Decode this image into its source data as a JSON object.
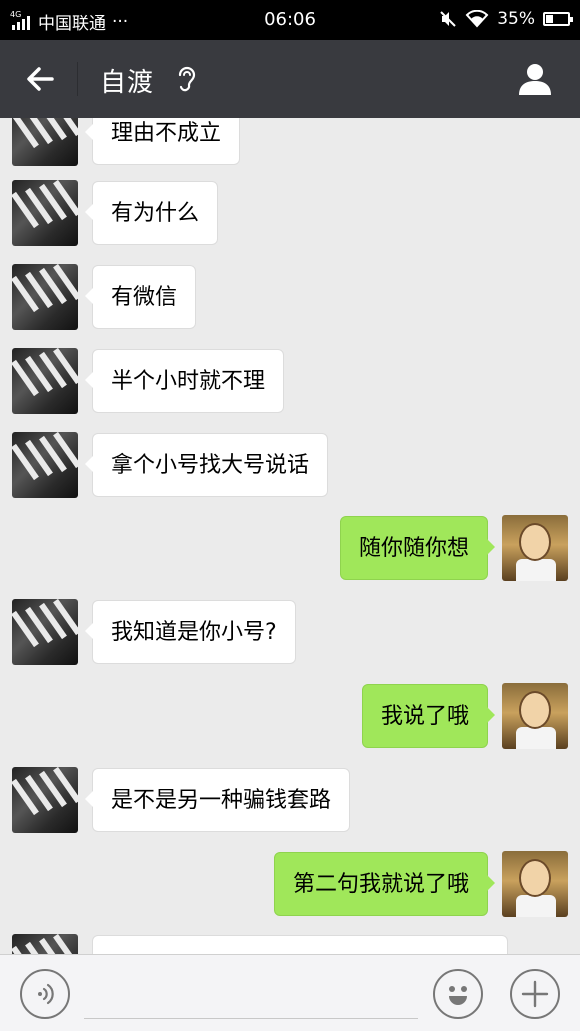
{
  "status_bar": {
    "network_tag": "4G",
    "carrier": "中国联通",
    "more": "···",
    "time": "06:06",
    "battery": "35%",
    "battery_level": 0.35
  },
  "header": {
    "title": "自渡"
  },
  "messages": [
    {
      "side": "left",
      "text": "理由不成立"
    },
    {
      "side": "left",
      "text": "有为什么"
    },
    {
      "side": "left",
      "text": "有微信"
    },
    {
      "side": "left",
      "text": "半个小时就不理"
    },
    {
      "side": "left",
      "text": "拿个小号找大号说话"
    },
    {
      "side": "right",
      "text": "随你随你想"
    },
    {
      "side": "left",
      "text": "我知道是你小号?"
    },
    {
      "side": "right",
      "text": "我说了哦"
    },
    {
      "side": "left",
      "text": "是不是另一种骗钱套路"
    },
    {
      "side": "right",
      "text": "第二句我就说了哦"
    },
    {
      "side": "left",
      "text": ""
    }
  ],
  "input": {
    "placeholder": ""
  },
  "colors": {
    "header_bg": "#393a3f",
    "chat_bg": "#ebebeb",
    "sent_bubble": "#a0e75a",
    "received_bubble": "#ffffff"
  }
}
